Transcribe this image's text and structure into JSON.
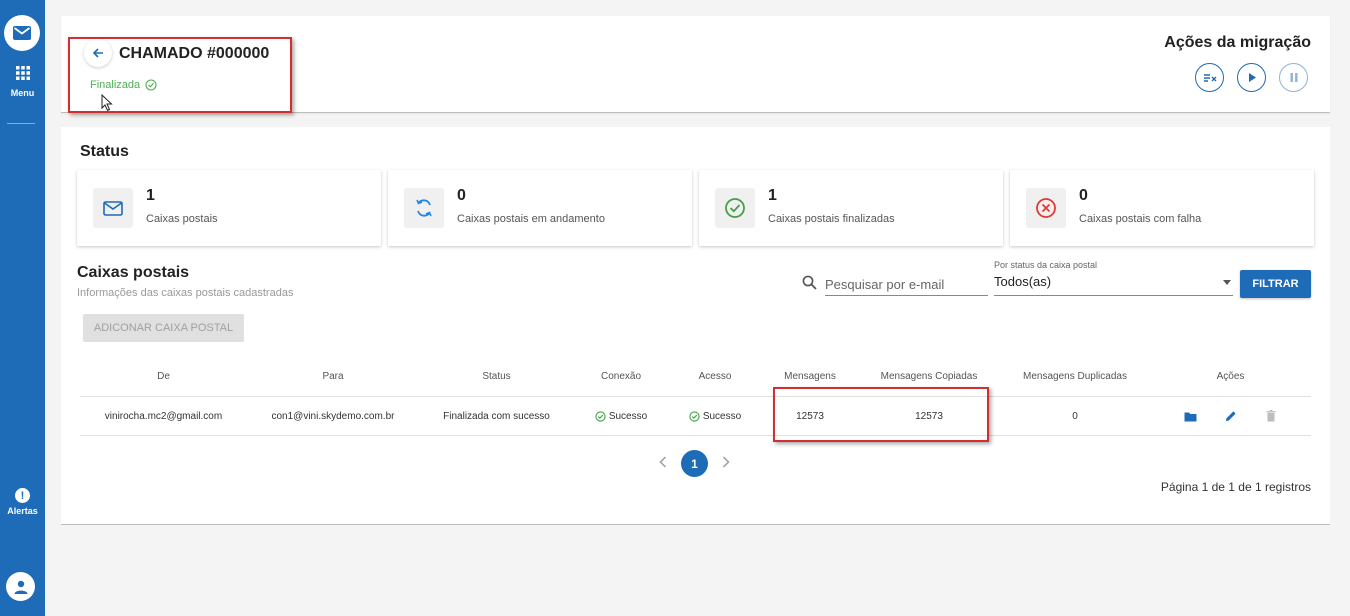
{
  "sidebar": {
    "menu_label": "Menu",
    "alerts_label": "Alertas",
    "alerts_glyph": "!"
  },
  "header": {
    "title": "CHAMADO #000000",
    "status": "Finalizada",
    "actions_title": "Ações da migração"
  },
  "status_section": {
    "title": "Status",
    "cards": [
      {
        "icon": "mail-icon",
        "value": "1",
        "label": "Caixas postais"
      },
      {
        "icon": "sync-icon",
        "value": "0",
        "label": "Caixas postais em andamento"
      },
      {
        "icon": "check-circle-icon",
        "value": "1",
        "label": "Caixas postais finalizadas"
      },
      {
        "icon": "error-circle-icon",
        "value": "0",
        "label": "Caixas postais com falha"
      }
    ]
  },
  "mailboxes": {
    "title": "Caixas postais",
    "subtitle": "Informações das caixas postais cadastradas",
    "search_placeholder": "Pesquisar por e-mail",
    "filter_label": "Por status da caixa postal",
    "filter_value": "Todos(as)",
    "filter_button": "FILTRAR",
    "add_button": "ADICONAR CAIXA POSTAL",
    "columns": [
      "De",
      "Para",
      "Status",
      "Conexão",
      "Acesso",
      "Mensagens",
      "Mensagens Copiadas",
      "Mensagens Duplicadas",
      "Ações"
    ],
    "rows": [
      {
        "from": "vinirocha.mc2@gmail.com",
        "to": "con1@vini.skydemo.com.br",
        "status": "Finalizada com sucesso",
        "connection": "Sucesso",
        "access": "Sucesso",
        "messages": "12573",
        "copied": "12573",
        "duplicated": "0"
      }
    ],
    "pagination": {
      "current_page": "1",
      "info": "Página 1 de 1 de 1 registros"
    }
  },
  "colors": {
    "primary": "#1e6bb8",
    "success": "#4caf50",
    "error": "#e53935",
    "highlight": "#d32f2f"
  }
}
